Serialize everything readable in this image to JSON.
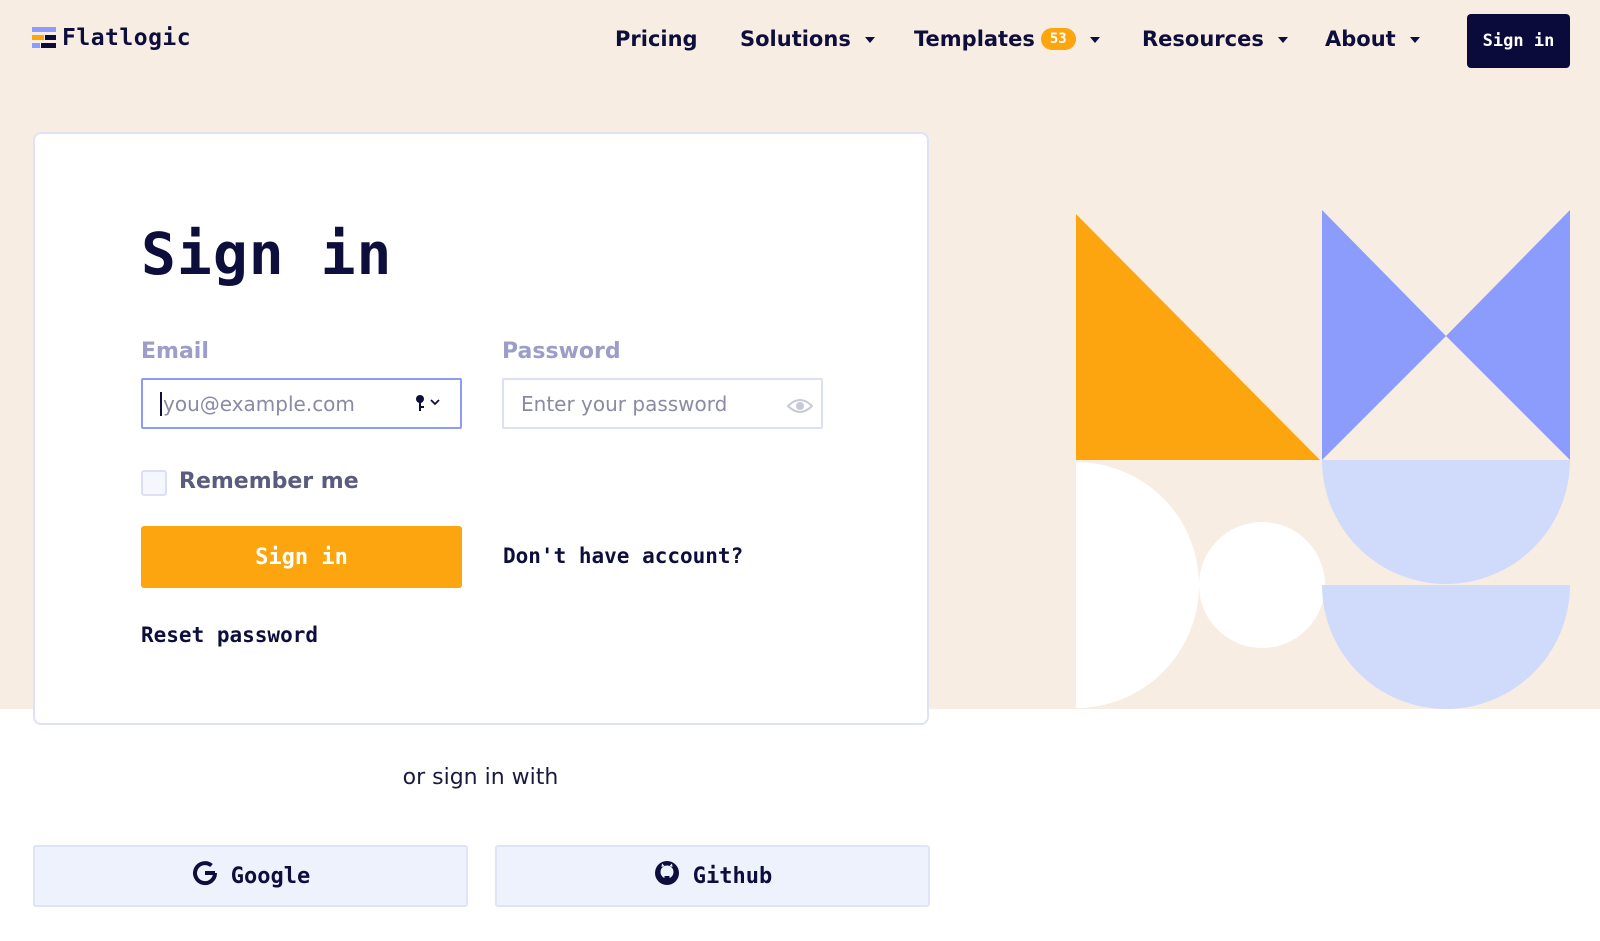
{
  "header": {
    "logo_text": "Flatlogic",
    "nav": [
      {
        "label": "Pricing",
        "dropdown": false
      },
      {
        "label": "Solutions",
        "dropdown": true
      },
      {
        "label": "Templates",
        "dropdown": true,
        "badge": "53"
      },
      {
        "label": "Resources",
        "dropdown": true
      },
      {
        "label": "About",
        "dropdown": true
      }
    ],
    "signin_label": "Sign in"
  },
  "form": {
    "title": "Sign in",
    "email_label": "Email",
    "email_placeholder": "you@example.com",
    "email_value": "",
    "password_label": "Password",
    "password_placeholder": "Enter your password",
    "password_value": "",
    "remember_label": "Remember me",
    "remember_checked": false,
    "submit_label": "Sign in",
    "signup_link": "Don't have account?",
    "reset_link": "Reset password"
  },
  "social": {
    "divider_text": "or sign in with",
    "google_label": "Google",
    "github_label": "Github"
  },
  "colors": {
    "accent": "#fca50f",
    "navy": "#0b0b3b",
    "periwinkle": "#8c9cfc",
    "light_blue": "#d0dafb",
    "cream": "#f7ede3"
  },
  "icons": [
    "key-icon",
    "chevron-down-icon",
    "eye-icon",
    "google-icon",
    "github-icon"
  ]
}
